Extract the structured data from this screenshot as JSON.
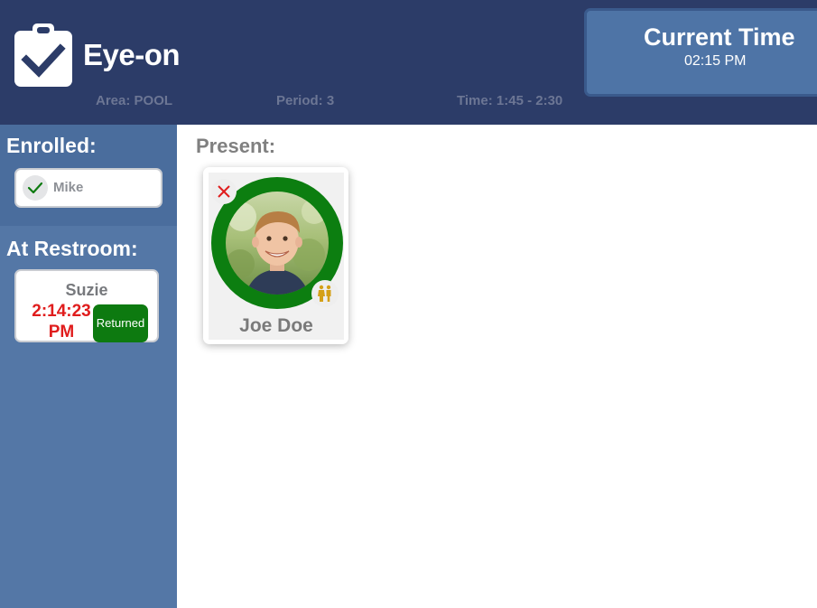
{
  "header": {
    "title": "Eye-on",
    "logo_icon": "clipboard-check-icon",
    "area": "Area: POOL",
    "period": "Period: 3",
    "time_range": "Time: 1:45 - 2:30"
  },
  "clock": {
    "label": "Current Time",
    "value": "02:15 PM"
  },
  "sidebar": {
    "enrolled_title": "Enrolled:",
    "enrolled": [
      {
        "name": "Mike",
        "icon": "checkmark-icon"
      }
    ],
    "restroom_title": "At Restroom:",
    "restroom": [
      {
        "name": "Suzie",
        "time": "2:14:23 PM",
        "action_label": "Returned"
      }
    ]
  },
  "main": {
    "present_title": "Present:",
    "students": [
      {
        "name": "Joe Doe",
        "remove_icon": "close-icon",
        "restroom_icon": "restroom-icon"
      }
    ]
  },
  "colors": {
    "header_bg": "#2c3c68",
    "sidebar_bg": "#5477a6",
    "present_ring": "#0c7e10",
    "returned_button": "#0d7a10",
    "alert_time": "#e01d1d",
    "restroom_icon": "#d4a017"
  }
}
